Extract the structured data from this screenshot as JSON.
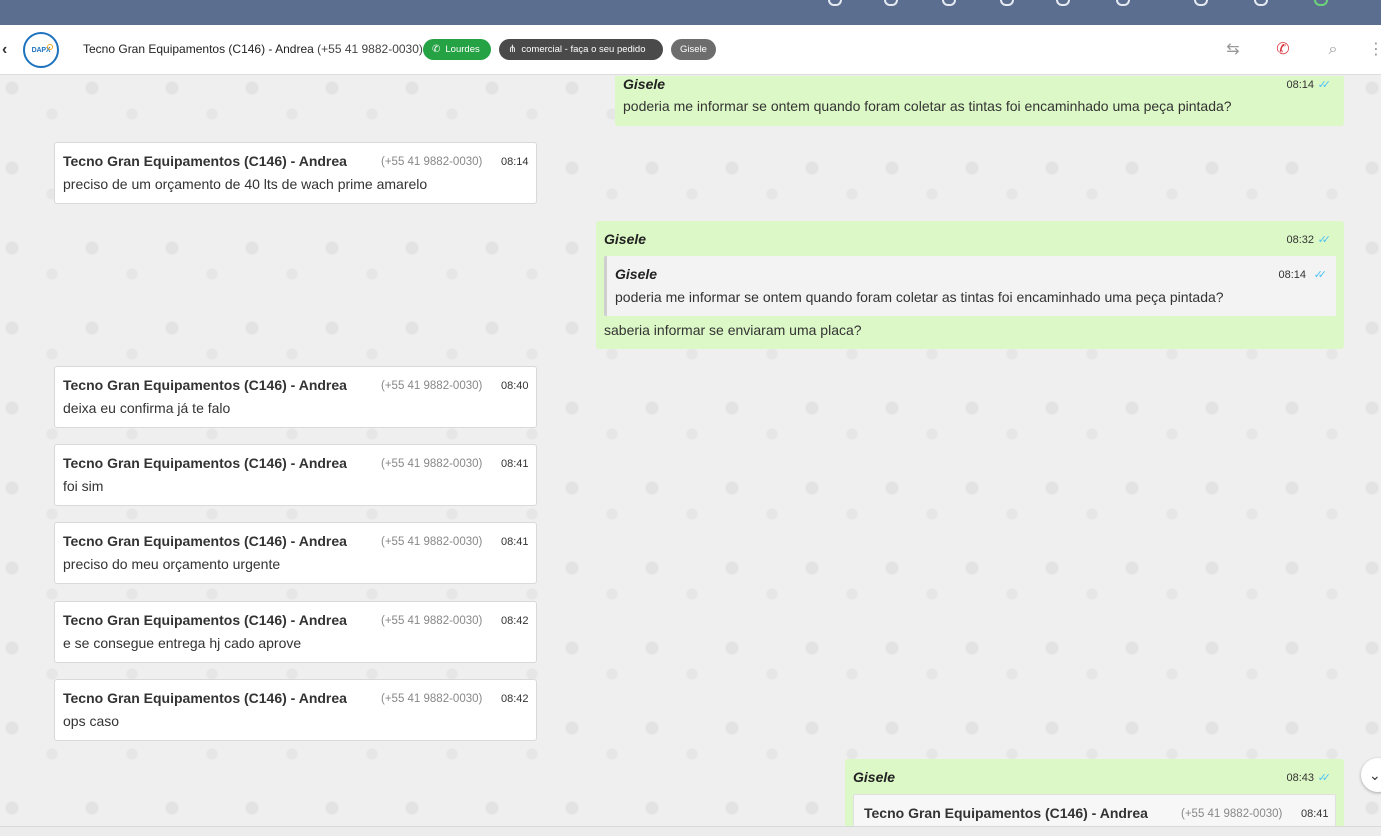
{
  "header": {
    "logo_text": "DAPX",
    "contact_name": "Tecno Gran Equipamentos (C146) - Andrea",
    "contact_phone": "(+55 41 9882-0030)",
    "tags": [
      {
        "label": "Lourdes",
        "color": "#25a244"
      },
      {
        "label": "comercial - faça o seu pedido",
        "color": "#4a4a4a"
      },
      {
        "label": "Gisele",
        "color": "#6d6d6d"
      }
    ]
  },
  "messages": [
    {
      "sender": "Gisele",
      "time": "08:14",
      "text": "poderia me informar se ontem quando foram coletar as tintas foi encaminhado uma peça pintada?"
    },
    {
      "sender": "Tecno Gran Equipamentos (C146) - Andrea",
      "phone": "(+55 41 9882-0030)",
      "time": "08:14",
      "text": "preciso de um orçamento de 40 lts de wach prime amarelo"
    },
    {
      "sender": "Gisele",
      "time": "08:32",
      "quote_sender": "Gisele",
      "quote_time": "08:14",
      "quote_text": "poderia me informar se ontem quando foram coletar as tintas foi encaminhado uma peça pintada?",
      "text": "saberia informar se enviaram uma placa?"
    },
    {
      "sender": "Tecno Gran Equipamentos (C146) - Andrea",
      "phone": "(+55 41 9882-0030)",
      "time": "08:40",
      "text": "deixa eu confirma já te falo"
    },
    {
      "sender": "Tecno Gran Equipamentos (C146) - Andrea",
      "phone": "(+55 41 9882-0030)",
      "time": "08:41",
      "text": "foi sim"
    },
    {
      "sender": "Tecno Gran Equipamentos (C146) - Andrea",
      "phone": "(+55 41 9882-0030)",
      "time": "08:41",
      "text": "preciso do meu orçamento urgente"
    },
    {
      "sender": "Tecno Gran Equipamentos (C146) - Andrea",
      "phone": "(+55 41 9882-0030)",
      "time": "08:42",
      "text": "e se consegue entrega hj cado aprove"
    },
    {
      "sender": "Tecno Gran Equipamentos (C146) - Andrea",
      "phone": "(+55 41 9882-0030)",
      "time": "08:42",
      "text": "ops caso"
    },
    {
      "sender": "Gisele",
      "time": "08:43",
      "quote_sender": "Tecno Gran Equipamentos (C146) - Andrea",
      "quote_phone": "(+55 41 9882-0030)",
      "quote_time": "08:41"
    }
  ],
  "colors": {
    "outgoing": "#dcf8c6",
    "incoming": "#ffffff",
    "topbar": "#5c6e8f",
    "read_ticks": "#4fc3f7"
  },
  "icons": {
    "ticks": "✓✓",
    "back": "‹",
    "scroll_down": "⌄"
  }
}
